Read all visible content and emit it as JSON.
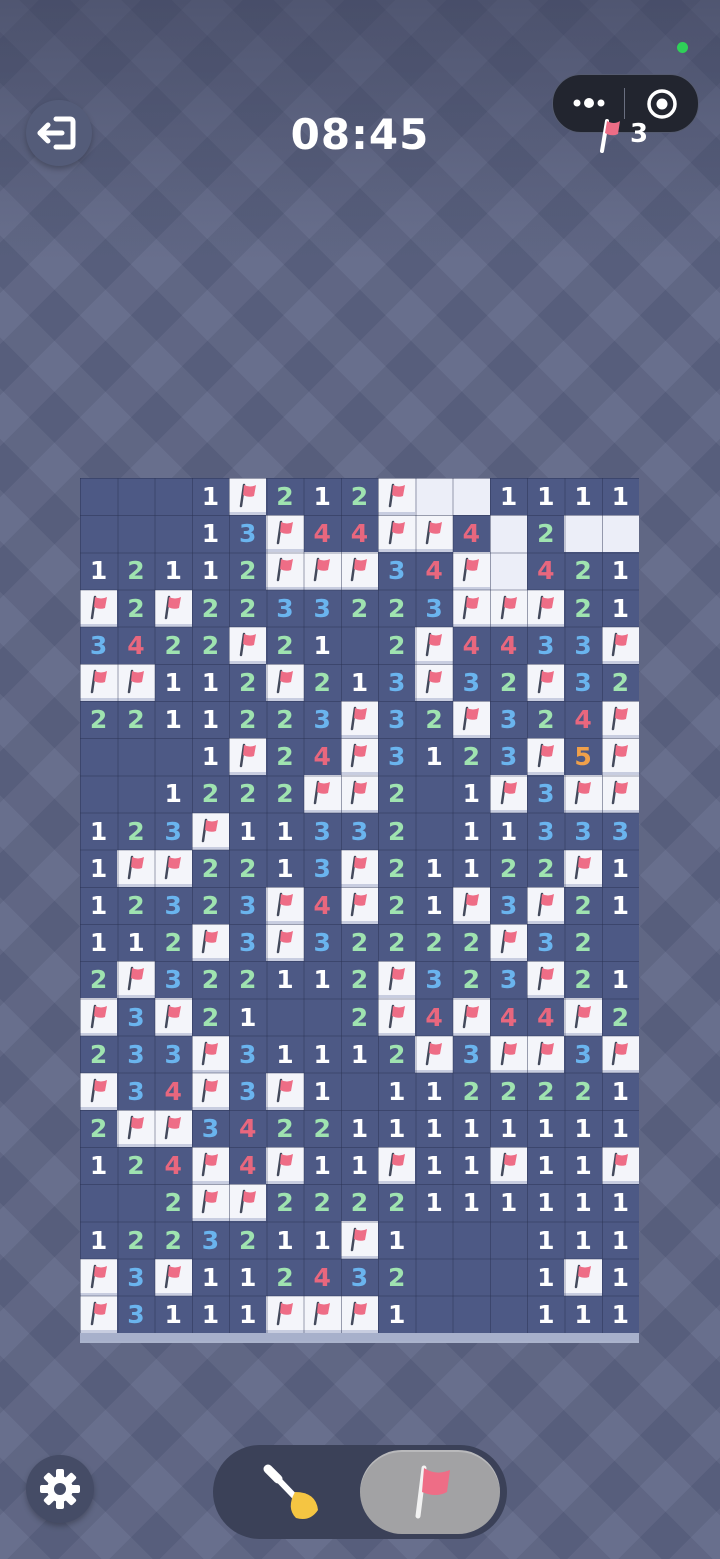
{
  "top_bar": {
    "timer": "08:45",
    "flags_remaining": "3",
    "icons": [
      "exit-icon",
      "more-icon",
      "target-icon",
      "flag-icon"
    ]
  },
  "board": {
    "columns": 15,
    "rows": 23,
    "legend": {
      "F": "flag",
      "H": "hidden",
      "0": "revealed-empty",
      "1-8": "adjacent mine count"
    },
    "cells": [
      "0001F212F00111",
      "0001 3F44FF4020H",
      "",
      "",
      "",
      "",
      "",
      "",
      "",
      "",
      "",
      "",
      "",
      "",
      "",
      "",
      "",
      "",
      "",
      "",
      "",
      "",
      ""
    ],
    "grid": [
      [
        "0",
        "0",
        "0",
        "1",
        "F",
        "2",
        "1",
        "2",
        "F",
        "H",
        "H",
        "1",
        "1",
        "1",
        "1"
      ],
      [
        "0",
        "0",
        "0",
        "1",
        "3",
        "F",
        "4",
        "4",
        "F",
        "F",
        "4",
        "H",
        "2",
        "H",
        "H"
      ],
      [
        "1",
        "2",
        "1",
        "1",
        "2",
        "F",
        "F",
        "F",
        "3",
        "4",
        "F",
        "H",
        "4",
        "2",
        "1"
      ],
      [
        "F",
        "2",
        "F",
        "2",
        "2",
        "3",
        "3",
        "2",
        "2",
        "3",
        "F",
        "F",
        "F",
        "2",
        "1"
      ],
      [
        "3",
        "4",
        "2",
        "2",
        "F",
        "2",
        "1",
        "0",
        "2",
        "F",
        "4",
        "4",
        "3",
        "3",
        "F"
      ],
      [
        "F",
        "F",
        "1",
        "1",
        "2",
        "F",
        "2",
        "1",
        "3",
        "F",
        "3",
        "2",
        "F",
        "3",
        "2"
      ],
      [
        "2",
        "2",
        "1",
        "1",
        "2",
        "2",
        "3",
        "F",
        "3",
        "2",
        "F",
        "3",
        "2",
        "4",
        "F"
      ],
      [
        "0",
        "0",
        "0",
        "1",
        "F",
        "2",
        "4",
        "F",
        "3",
        "1",
        "2",
        "3",
        "F",
        "5",
        "F"
      ],
      [
        "0",
        "0",
        "1",
        "2",
        "2",
        "2",
        "F",
        "F",
        "2",
        "0",
        "1",
        "F",
        "3",
        "F",
        "F"
      ],
      [
        "1",
        "2",
        "3",
        "F",
        "1",
        "1",
        "3",
        "3",
        "2",
        "0",
        "1",
        "1",
        "3",
        "3",
        "3"
      ],
      [
        "1",
        "F",
        "F",
        "2",
        "2",
        "1",
        "3",
        "F",
        "2",
        "1",
        "1",
        "2",
        "2",
        "F",
        "1"
      ],
      [
        "1",
        "2",
        "3",
        "2",
        "3",
        "F",
        "4",
        "F",
        "2",
        "1",
        "F",
        "3",
        "F",
        "2",
        "1"
      ],
      [
        "1",
        "1",
        "2",
        "F",
        "3",
        "F",
        "3",
        "2",
        "2",
        "2",
        "2",
        "F",
        "3",
        "2",
        "0"
      ],
      [
        "2",
        "F",
        "3",
        "2",
        "2",
        "1",
        "1",
        "2",
        "F",
        "3",
        "2",
        "3",
        "F",
        "2",
        "1"
      ],
      [
        "F",
        "3",
        "F",
        "2",
        "1",
        "0",
        "0",
        "2",
        "F",
        "4",
        "F",
        "4",
        "4",
        "F",
        "2"
      ],
      [
        "2",
        "3",
        "3",
        "F",
        "3",
        "1",
        "1",
        "1",
        "2",
        "F",
        "3",
        "F",
        "F",
        "3",
        "F"
      ],
      [
        "F",
        "3",
        "4",
        "F",
        "3",
        "F",
        "1",
        "0",
        "1",
        "1",
        "2",
        "2",
        "2",
        "2",
        "1"
      ],
      [
        "2",
        "F",
        "F",
        "3",
        "4",
        "2",
        "2",
        "1",
        "1",
        "1",
        "1",
        "1",
        "1",
        "1",
        "1"
      ],
      [
        "1",
        "2",
        "4",
        "F",
        "4",
        "F",
        "1",
        "1",
        "F",
        "1",
        "1",
        "F",
        "1",
        "1",
        "F"
      ],
      [
        "0",
        "0",
        "2",
        "F",
        "F",
        "2",
        "2",
        "2",
        "2",
        "1",
        "1",
        "1",
        "1",
        "1",
        "1"
      ],
      [
        "1",
        "2",
        "2",
        "3",
        "2",
        "1",
        "1",
        "F",
        "1",
        "0",
        "0",
        "0",
        "1",
        "1",
        "1"
      ],
      [
        "F",
        "3",
        "F",
        "1",
        "1",
        "2",
        "4",
        "3",
        "2",
        "0",
        "0",
        "0",
        "1",
        "F",
        "1"
      ],
      [
        "F",
        "3",
        "1",
        "1",
        "1",
        "F",
        "F",
        "F",
        "1",
        "0",
        "0",
        "0",
        "1",
        "1",
        "1"
      ]
    ]
  },
  "number_colors": {
    "1": "#ffffff",
    "2": "#9fe3b0",
    "3": "#6ab4ee",
    "4": "#e8677e",
    "5": "#f0a04a"
  },
  "colors": {
    "board": "#4d5985",
    "flag_cell": "#f4f5fa",
    "flag_red": "#ee6d86",
    "background": "#5d6585"
  },
  "bottom_bar": {
    "modes": [
      "dig-shovel-icon",
      "flag-icon"
    ],
    "active_mode": "flag",
    "settings_icon": "gear-icon"
  }
}
